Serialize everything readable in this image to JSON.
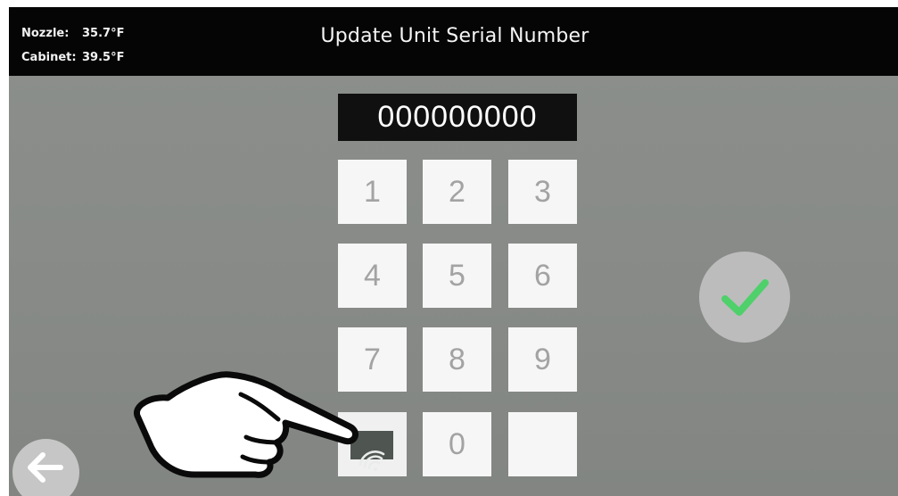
{
  "header": {
    "nozzle_label": "Nozzle:",
    "nozzle_value": "35.7°F",
    "cabinet_label": "Cabinet:",
    "cabinet_value": "39.5°F",
    "title": "Update Unit Serial Number"
  },
  "serial": {
    "value": "000000000"
  },
  "keypad": {
    "keys": [
      "1",
      "2",
      "3",
      "4",
      "5",
      "6",
      "7",
      "8",
      "9",
      "",
      "0",
      ""
    ],
    "special_key_icon": "wifi-icon"
  },
  "icons": {
    "confirm": "check-icon",
    "back": "arrow-left-icon",
    "pointer": "pointing-hand-icon"
  },
  "colors": {
    "header_bg": "#050505",
    "screen_bg": "#898c89",
    "key_bg": "#f6f6f6",
    "key_text": "#a3a3a3",
    "check_green": "#4fd06a"
  }
}
